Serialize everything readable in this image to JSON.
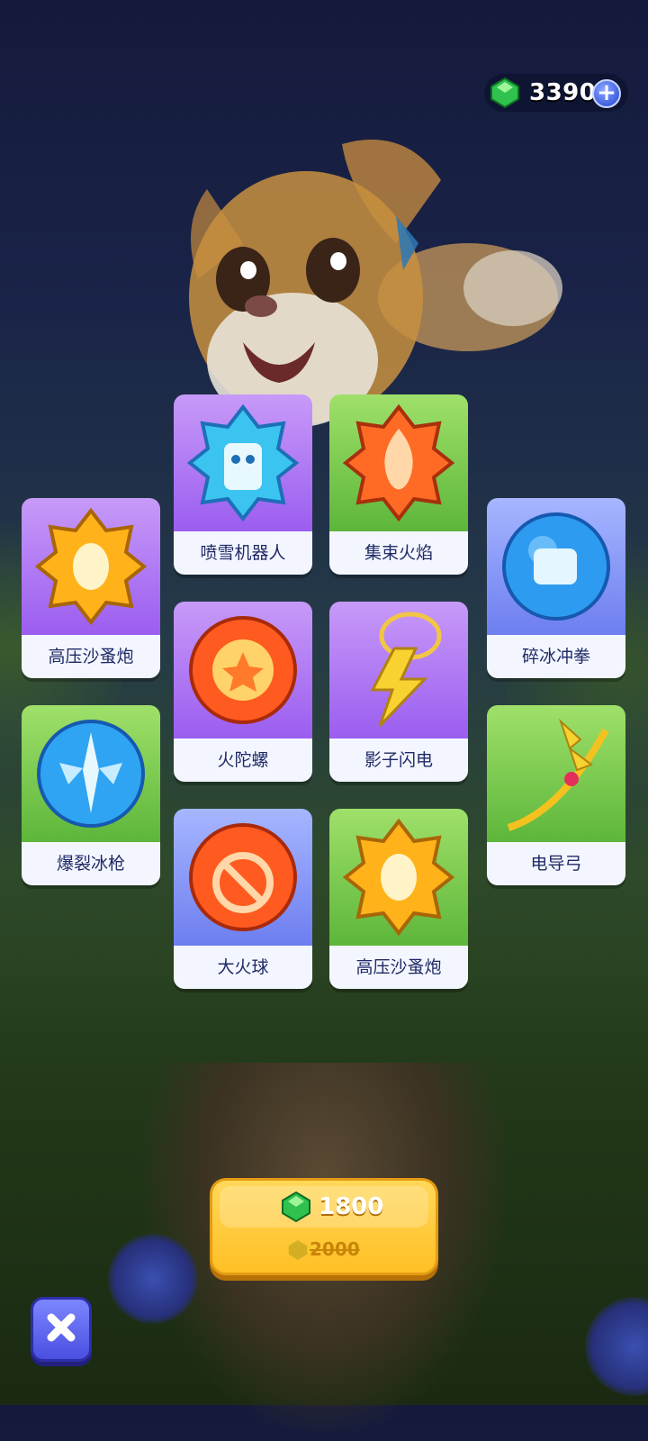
{
  "currency": {
    "amount": "3390",
    "add_label": "+"
  },
  "cards": [
    {
      "label": "喷雪机器人",
      "bg": "purple",
      "icon": "snow-robot-icon"
    },
    {
      "label": "集束火焰",
      "bg": "green",
      "icon": "cluster-flame-icon"
    },
    {
      "label": "高压沙蚤炮",
      "bg": "purple",
      "icon": "sandflea-cannon-icon"
    },
    {
      "label": "碎冰冲拳",
      "bg": "blue",
      "icon": "ice-punch-icon"
    },
    {
      "label": "火陀螺",
      "bg": "purple",
      "icon": "fire-top-icon"
    },
    {
      "label": "影子闪电",
      "bg": "purple",
      "icon": "shadow-lightning-icon"
    },
    {
      "label": "爆裂冰枪",
      "bg": "green",
      "icon": "burst-ice-spear-icon"
    },
    {
      "label": "电导弓",
      "bg": "green",
      "icon": "conductive-bow-icon"
    },
    {
      "label": "大火球",
      "bg": "blue",
      "icon": "big-fireball-icon"
    },
    {
      "label": "高压沙蚤炮",
      "bg": "green",
      "icon": "sandflea-cannon-icon"
    }
  ],
  "purchase": {
    "price": "1800",
    "original_price": "2000"
  },
  "close": {
    "label": "✕"
  }
}
